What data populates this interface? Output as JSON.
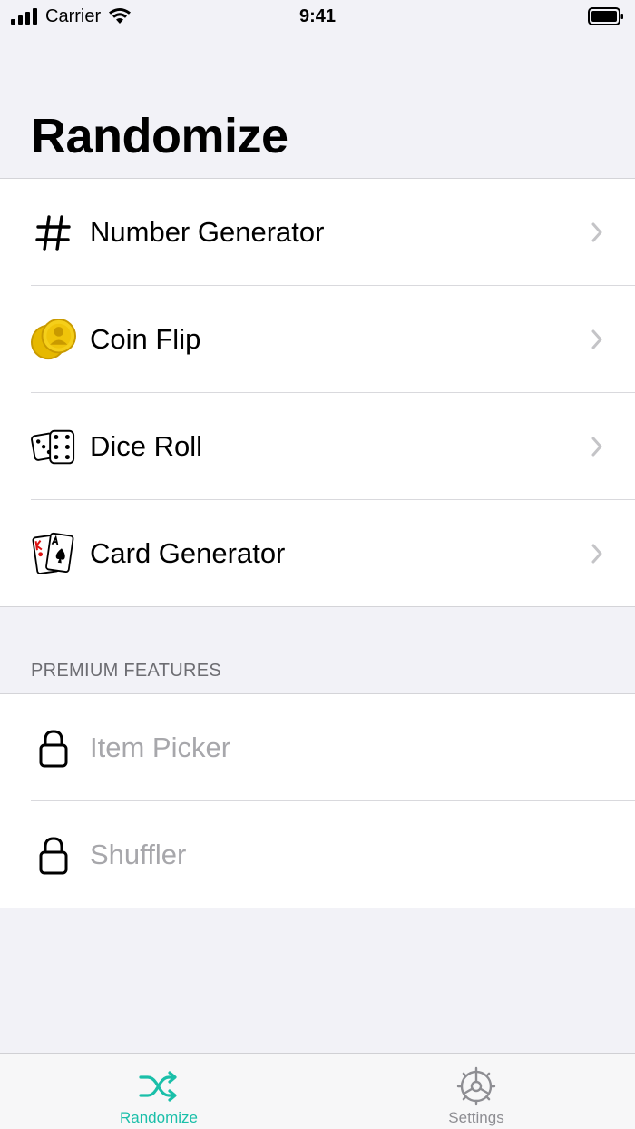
{
  "status_bar": {
    "carrier": "Carrier",
    "time": "9:41"
  },
  "page": {
    "title": "Randomize"
  },
  "menu": {
    "items": [
      {
        "label": "Number Generator",
        "icon": "hash-icon"
      },
      {
        "label": "Coin Flip",
        "icon": "coin-icon"
      },
      {
        "label": "Dice Roll",
        "icon": "dice-icon"
      },
      {
        "label": "Card Generator",
        "icon": "cards-icon"
      }
    ]
  },
  "premium": {
    "header": "PREMIUM FEATURES",
    "items": [
      {
        "label": "Item Picker",
        "icon": "lock-icon",
        "locked": true
      },
      {
        "label": "Shuffler",
        "icon": "lock-icon",
        "locked": true
      }
    ]
  },
  "tab_bar": {
    "tabs": [
      {
        "label": "Randomize",
        "icon": "shuffle-icon",
        "selected": true
      },
      {
        "label": "Settings",
        "icon": "gear-icon",
        "selected": false
      }
    ]
  },
  "colors": {
    "accent": "#1abfa9",
    "disabled_text": "#a7a7ab",
    "background": "#f2f2f7"
  }
}
